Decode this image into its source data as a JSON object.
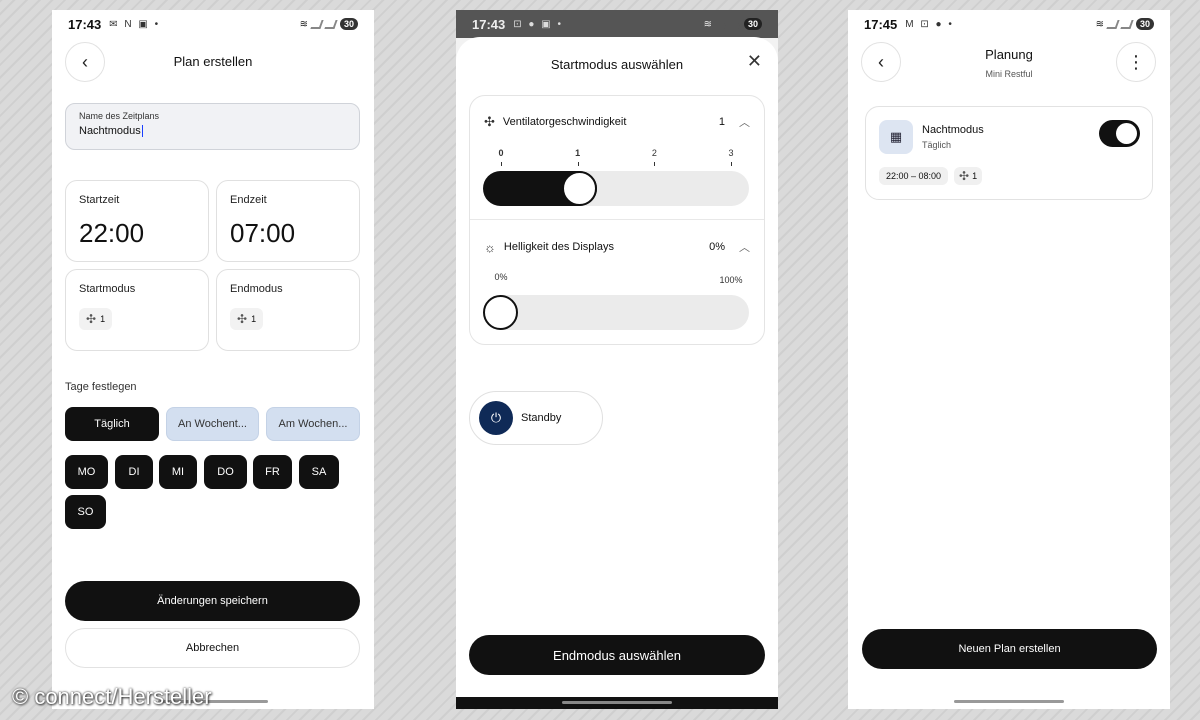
{
  "phone1": {
    "status": {
      "time": "17:43",
      "icons": "✉ N ▣ •",
      "battery": "30"
    },
    "header": {
      "title": "Plan erstellen",
      "back_icon": "chevron-left-icon"
    },
    "name_field": {
      "label": "Name des Zeitplans",
      "value": "Nachtmodus"
    },
    "start_time": {
      "label": "Startzeit",
      "value": "22:00"
    },
    "end_time": {
      "label": "Endzeit",
      "value": "07:00"
    },
    "start_mode": {
      "label": "Startmodus",
      "value": "1"
    },
    "end_mode": {
      "label": "Endmodus",
      "value": "1"
    },
    "days_section": {
      "label": "Tage festlegen"
    },
    "day_tabs": [
      {
        "label": "Täglich",
        "active": true
      },
      {
        "label": "An Wochent...",
        "active": false
      },
      {
        "label": "Am Wochen...",
        "active": false
      }
    ],
    "days": [
      "MO",
      "DI",
      "MI",
      "DO",
      "FR",
      "SA",
      "SO"
    ],
    "save_label": "Änderungen speichern",
    "cancel_label": "Abbrechen"
  },
  "phone2": {
    "status": {
      "time": "17:43",
      "icons": "⊡ ● ▣ •",
      "battery": "30"
    },
    "sheet_title": "Startmodus auswählen",
    "fan": {
      "label": "Ventilatorgeschwindigkeit",
      "value": "1",
      "ticks": [
        "0",
        "1",
        "2",
        "3"
      ],
      "level": 1,
      "max": 3
    },
    "brightness": {
      "label": "Helligkeit des Displays",
      "value": "0%",
      "tick_min": "0%",
      "tick_max": "100%",
      "level": 0
    },
    "standby_label": "Standby",
    "end_button": "Endmodus auswählen"
  },
  "phone3": {
    "status": {
      "time": "17:45",
      "icons": "M ⊡ ● •",
      "battery": "30"
    },
    "title": "Planung",
    "subtitle": "Mini Restful",
    "plan": {
      "name": "Nachtmodus",
      "frequency": "Täglich",
      "time_range": "22:00 – 08:00",
      "fan_value": "1",
      "enabled": true
    },
    "new_button": "Neuen Plan erstellen"
  },
  "watermark": "© connect/Hersteller"
}
